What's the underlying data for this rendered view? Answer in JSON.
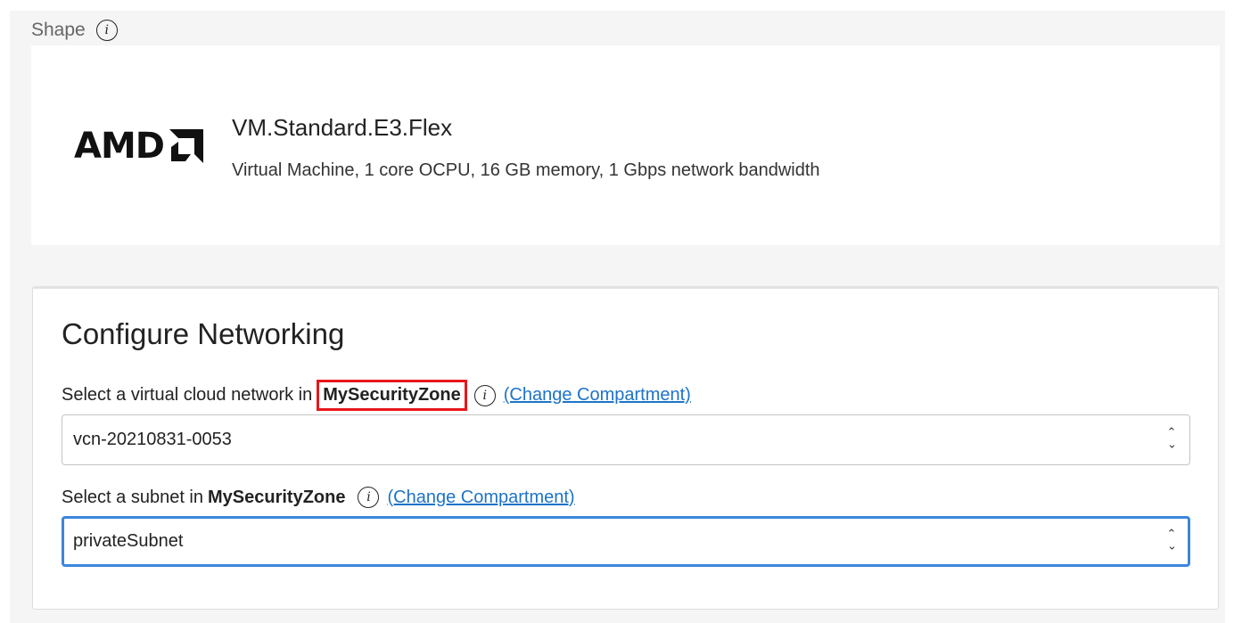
{
  "shape": {
    "label": "Shape",
    "logo_text": "AMD",
    "name": "VM.Standard.E3.Flex",
    "description": "Virtual Machine, 1 core OCPU, 16 GB memory, 1 Gbps network bandwidth"
  },
  "networking": {
    "title": "Configure Networking",
    "vcn": {
      "label": "Select a virtual cloud network in",
      "compartment": "MySecurityZone",
      "change_link": "(Change Compartment)",
      "value": "vcn-20210831-0053"
    },
    "subnet": {
      "label": "Select a subnet in",
      "compartment": "MySecurityZone",
      "change_link": "(Change Compartment)",
      "value": "privateSubnet"
    }
  },
  "colors": {
    "link": "#1e73c8",
    "highlight": "#e8161b",
    "focus": "#3d86db"
  }
}
